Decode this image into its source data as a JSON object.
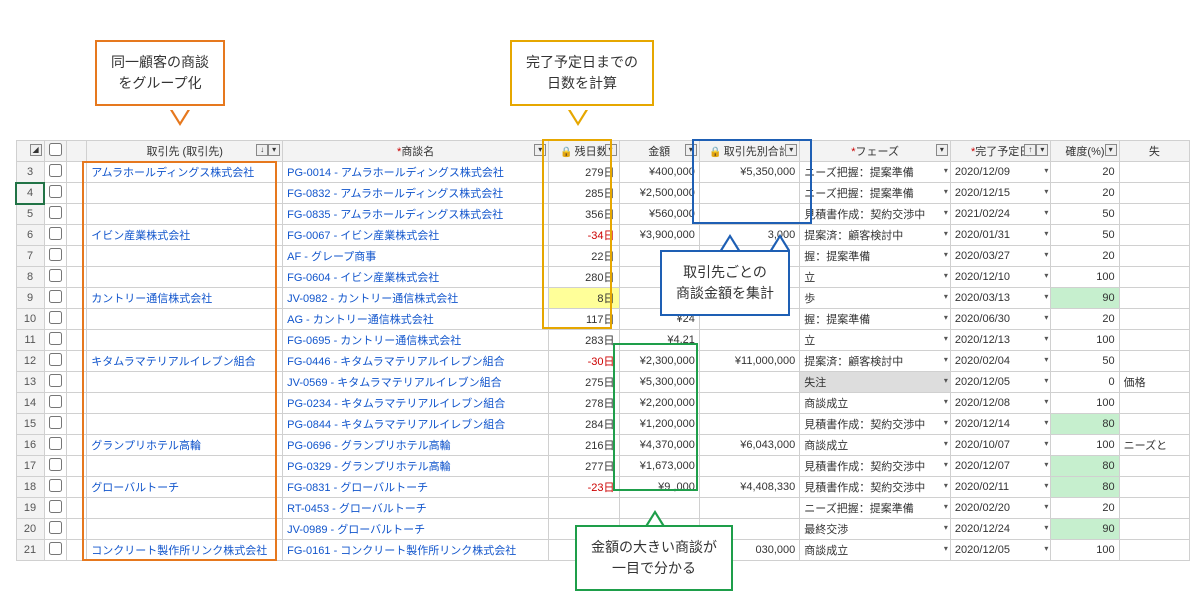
{
  "callouts": {
    "orange": "同一顧客の商談\nをグループ化",
    "yellow": "完了予定日までの\n日数を計算",
    "blue": "取引先ごとの\n商談金額を集計",
    "green": "金額の大きい商談が\n一目で分かる"
  },
  "headers": {
    "client": "取引先 (取引先)",
    "deal": "商談名",
    "days": "残日数",
    "amount": "金額",
    "sum": "取引先別合計",
    "phase": "フェーズ",
    "date": "完了予定日",
    "prob": "確度(%)",
    "lost": "失"
  },
  "rows": [
    {
      "n": "3",
      "client": "アムラホールディングス株式会社",
      "deal": "PG-0014 - アムラホールディングス株式会社",
      "days": "279日",
      "amount": "¥400,000",
      "sum": "¥5,350,000",
      "phase": "ニーズ把握：提案準備",
      "date": "2020/12/09",
      "prob": "20",
      "lost": ""
    },
    {
      "n": "4",
      "client": "",
      "deal": "FG-0832 - アムラホールディングス株式会社",
      "days": "285日",
      "amount": "¥2,500,000",
      "sum": "",
      "phase": "ニーズ把握：提案準備",
      "date": "2020/12/15",
      "prob": "20",
      "lost": "",
      "sel": true
    },
    {
      "n": "5",
      "client": "",
      "deal": "FG-0835 - アムラホールディングス株式会社",
      "days": "356日",
      "amount": "¥560,000",
      "sum": "",
      "phase": "見積書作成：契約交渉中",
      "date": "2021/02/24",
      "prob": "50",
      "lost": ""
    },
    {
      "n": "6",
      "client": "イビン産業株式会社",
      "deal": "FG-0067 - イビン産業株式会社",
      "days": "-34日",
      "neg": true,
      "amount": "¥3,900,000",
      "sum": "3,000",
      "phase": "提案済：顧客検討中",
      "date": "2020/01/31",
      "prob": "50",
      "lost": ""
    },
    {
      "n": "7",
      "client": "",
      "deal": "AF - グレープ商事",
      "days": "22日",
      "amount": "¥29",
      "sum": "",
      "phase": "握：提案準備",
      "date": "2020/03/27",
      "prob": "20",
      "lost": ""
    },
    {
      "n": "8",
      "client": "",
      "deal": "FG-0604 - イビン産業株式会社",
      "days": "280日",
      "amount": "¥3,42",
      "sum": "",
      "phase": "立",
      "date": "2020/12/10",
      "prob": "100",
      "lost": ""
    },
    {
      "n": "9",
      "client": "カントリー通信株式会社",
      "deal": "JV-0982 - カントリー通信株式会社",
      "days": "8日",
      "dayHl": true,
      "amount": "¥2,45",
      "sum": "",
      "phase": "歩",
      "date": "2020/03/13",
      "prob": "90",
      "probHl": true,
      "lost": ""
    },
    {
      "n": "10",
      "client": "",
      "deal": "AG - カントリー通信株式会社",
      "days": "117日",
      "amount": "¥24",
      "sum": "",
      "phase": "握：提案準備",
      "date": "2020/06/30",
      "prob": "20",
      "lost": ""
    },
    {
      "n": "11",
      "client": "",
      "deal": "FG-0695 - カントリー通信株式会社",
      "days": "283日",
      "amount": "¥4,21",
      "sum": "",
      "phase": "立",
      "date": "2020/12/13",
      "prob": "100",
      "lost": ""
    },
    {
      "n": "12",
      "client": "キタムラマテリアルイレブン組合",
      "deal": "FG-0446 - キタムラマテリアルイレブン組合",
      "days": "-30日",
      "neg": true,
      "amount": "¥2,300,000",
      "sum": "¥11,000,000",
      "phase": "提案済：顧客検討中",
      "date": "2020/02/04",
      "prob": "50",
      "lost": ""
    },
    {
      "n": "13",
      "client": "",
      "deal": "JV-0569 - キタムラマテリアルイレブン組合",
      "days": "275日",
      "amount": "¥5,300,000",
      "sum": "",
      "phase": "失注",
      "phaseBlk": true,
      "date": "2020/12/05",
      "prob": "0",
      "lost": "価格"
    },
    {
      "n": "14",
      "client": "",
      "deal": "PG-0234 - キタムラマテリアルイレブン組合",
      "days": "278日",
      "amount": "¥2,200,000",
      "sum": "",
      "phase": "商談成立",
      "date": "2020/12/08",
      "prob": "100",
      "lost": ""
    },
    {
      "n": "15",
      "client": "",
      "deal": "PG-0844 - キタムラマテリアルイレブン組合",
      "days": "284日",
      "amount": "¥1,200,000",
      "sum": "",
      "phase": "見積書作成：契約交渉中",
      "date": "2020/12/14",
      "prob": "80",
      "probHl": true,
      "lost": ""
    },
    {
      "n": "16",
      "client": "グランプリホテル高輪",
      "deal": "PG-0696 - グランプリホテル高輪",
      "days": "216日",
      "amount": "¥4,370,000",
      "sum": "¥6,043,000",
      "phase": "商談成立",
      "date": "2020/10/07",
      "prob": "100",
      "lost": "ニーズと"
    },
    {
      "n": "17",
      "client": "",
      "deal": "PG-0329 - グランプリホテル高輪",
      "days": "277日",
      "amount": "¥1,673,000",
      "sum": "",
      "phase": "見積書作成：契約交渉中",
      "date": "2020/12/07",
      "prob": "80",
      "probHl": true,
      "lost": ""
    },
    {
      "n": "18",
      "client": "グローバルトーチ",
      "deal": "FG-0831 - グローバルトーチ",
      "days": "-23日",
      "neg": true,
      "amount": "¥9   ,000",
      "sum": "¥4,408,330",
      "phase": "見積書作成：契約交渉中",
      "date": "2020/02/11",
      "prob": "80",
      "probHl": true,
      "lost": ""
    },
    {
      "n": "19",
      "client": "",
      "deal": "RT-0453 - グローバルトーチ",
      "days": "",
      "amount": "",
      "sum": "",
      "phase": "ニーズ把握：提案準備",
      "date": "2020/02/20",
      "prob": "20",
      "lost": ""
    },
    {
      "n": "20",
      "client": "",
      "deal": "JV-0989 - グローバルトーチ",
      "days": "",
      "amount": "",
      "sum": "",
      "phase": "最終交渉",
      "date": "2020/12/24",
      "prob": "90",
      "probHl": true,
      "lost": ""
    },
    {
      "n": "21",
      "client": "コンクリート製作所リンク株式会社",
      "deal": "FG-0161 - コンクリート製作所リンク株式会社",
      "days": "",
      "amount": "",
      "sum": "030,000",
      "phase": "商談成立",
      "date": "2020/12/05",
      "prob": "100",
      "lost": ""
    }
  ]
}
